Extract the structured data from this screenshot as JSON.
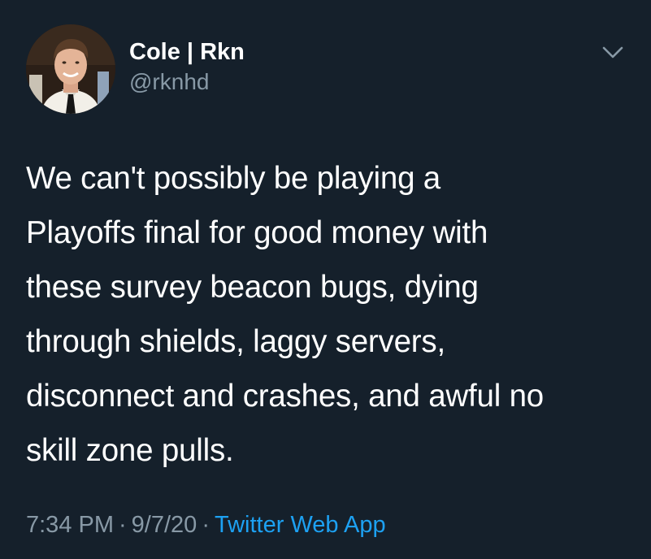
{
  "user": {
    "display_name": "Cole | Rkn",
    "handle": "@rknhd"
  },
  "tweet": {
    "lines": [
      "We can't possibly be playing a",
      "Playoffs final for good money with",
      "these survey beacon bugs, dying",
      "through shields, laggy servers,",
      "disconnect and crashes, and awful no",
      "skill zone pulls."
    ]
  },
  "meta": {
    "time": "7:34 PM",
    "separator": "·",
    "date": "9/7/20",
    "source": "Twitter Web App"
  },
  "icons": {
    "menu": "chevron-down-icon"
  },
  "colors": {
    "background": "#15202b",
    "primary_text": "#ffffff",
    "secondary_text": "#8899a6",
    "link": "#1da1f2"
  }
}
